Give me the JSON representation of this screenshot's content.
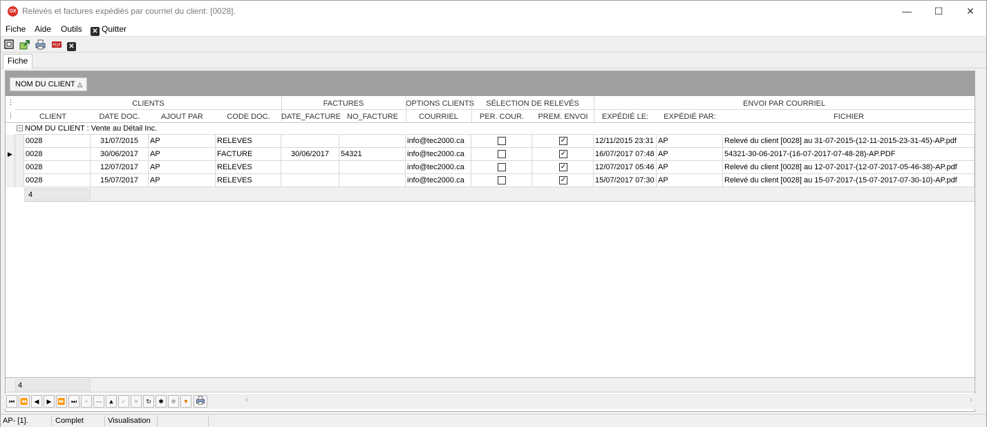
{
  "window": {
    "title": "Relevés et factures expédiés par courriel du client: [0028].",
    "app_icon_label": "OX"
  },
  "menu": {
    "items": [
      "Fiche",
      "Aide",
      "Outils"
    ],
    "quit_label": "Quitter"
  },
  "tabs": [
    "Fiche"
  ],
  "grouping": {
    "chip_label": "NOM DU CLIENT"
  },
  "grid": {
    "bands": [
      "CLIENTS",
      "FACTURES",
      "OPTIONS CLIENTS",
      "SÉLECTION DE RELEVÉS",
      "ENVOI PAR COURRIEL"
    ],
    "columns": [
      "CLIENT",
      "DATE  DOC.",
      "AJOUT PAR",
      "CODE DOC.",
      "DATE_FACTURE",
      "NO_FACTURE",
      "COURRIEL",
      "PER. COUR.",
      "PREM. ENVOI",
      "EXPÉDIÉ LE:",
      "EXPÉDIÉ PAR:",
      "FICHIER"
    ],
    "group_label": "NOM DU CLIENT : Vente au Détail Inc.",
    "rows": [
      {
        "client": "0028",
        "date_doc": "31/07/2015",
        "ajout_par": "AP",
        "code_doc": "RELEVES",
        "date_facture": "",
        "no_facture": "",
        "courriel": "info@tec2000.ca",
        "per_cour": false,
        "prem_envoi": true,
        "expedie_le": "12/11/2015 23:31",
        "expedie_par": "AP",
        "fichier": "Relevé du client [0028] au 31-07-2015-(12-11-2015-23-31-45)-AP.pdf",
        "current": false
      },
      {
        "client": "0028",
        "date_doc": "30/06/2017",
        "ajout_par": "AP",
        "code_doc": "FACTURE",
        "date_facture": "30/06/2017",
        "no_facture": "54321",
        "courriel": "info@tec2000.ca",
        "per_cour": false,
        "prem_envoi": true,
        "expedie_le": "16/07/2017 07:48",
        "expedie_par": "AP",
        "fichier": "54321-30-06-2017-(16-07-2017-07-48-28)-AP.PDF",
        "current": true
      },
      {
        "client": "0028",
        "date_doc": "12/07/2017",
        "ajout_par": "AP",
        "code_doc": "RELEVES",
        "date_facture": "",
        "no_facture": "",
        "courriel": "info@tec2000.ca",
        "per_cour": false,
        "prem_envoi": true,
        "expedie_le": "12/07/2017 05:46",
        "expedie_par": "AP",
        "fichier": "Relevé du client [0028] au 12-07-2017-(12-07-2017-05-46-38)-AP.pdf",
        "current": false
      },
      {
        "client": "0028",
        "date_doc": "15/07/2017",
        "ajout_par": "AP",
        "code_doc": "RELEVES",
        "date_facture": "",
        "no_facture": "",
        "courriel": "info@tec2000.ca",
        "per_cour": false,
        "prem_envoi": true,
        "expedie_le": "15/07/2017 07:30",
        "expedie_par": "AP",
        "fichier": "Relevé du client [0028] au 15-07-2017-(15-07-2017-07-30-10)-AP.pdf",
        "current": false
      }
    ],
    "group_count": "4",
    "footer_count": "4"
  },
  "status": {
    "user": "AP- [1].",
    "state": "Complet",
    "mode": "Visualisation"
  },
  "icons": {
    "toolbar": [
      "fit-window-icon",
      "export-icon",
      "print-icon",
      "pdf-icon",
      "close-icon"
    ],
    "navigator": [
      "first-icon",
      "prev-page-icon",
      "prev-icon",
      "next-icon",
      "next-page-icon",
      "last-icon",
      "insert-icon",
      "delete-icon",
      "edit-icon",
      "post-icon",
      "cancel-icon",
      "refresh-icon",
      "bookmark-icon",
      "goto-bookmark-icon",
      "filter-icon",
      "print-icon"
    ]
  },
  "colors": {
    "group_bar": "#a0a0a0",
    "title_text": "#7a7a7a",
    "app_icon": "#d9322b",
    "header_text": "#333333"
  }
}
